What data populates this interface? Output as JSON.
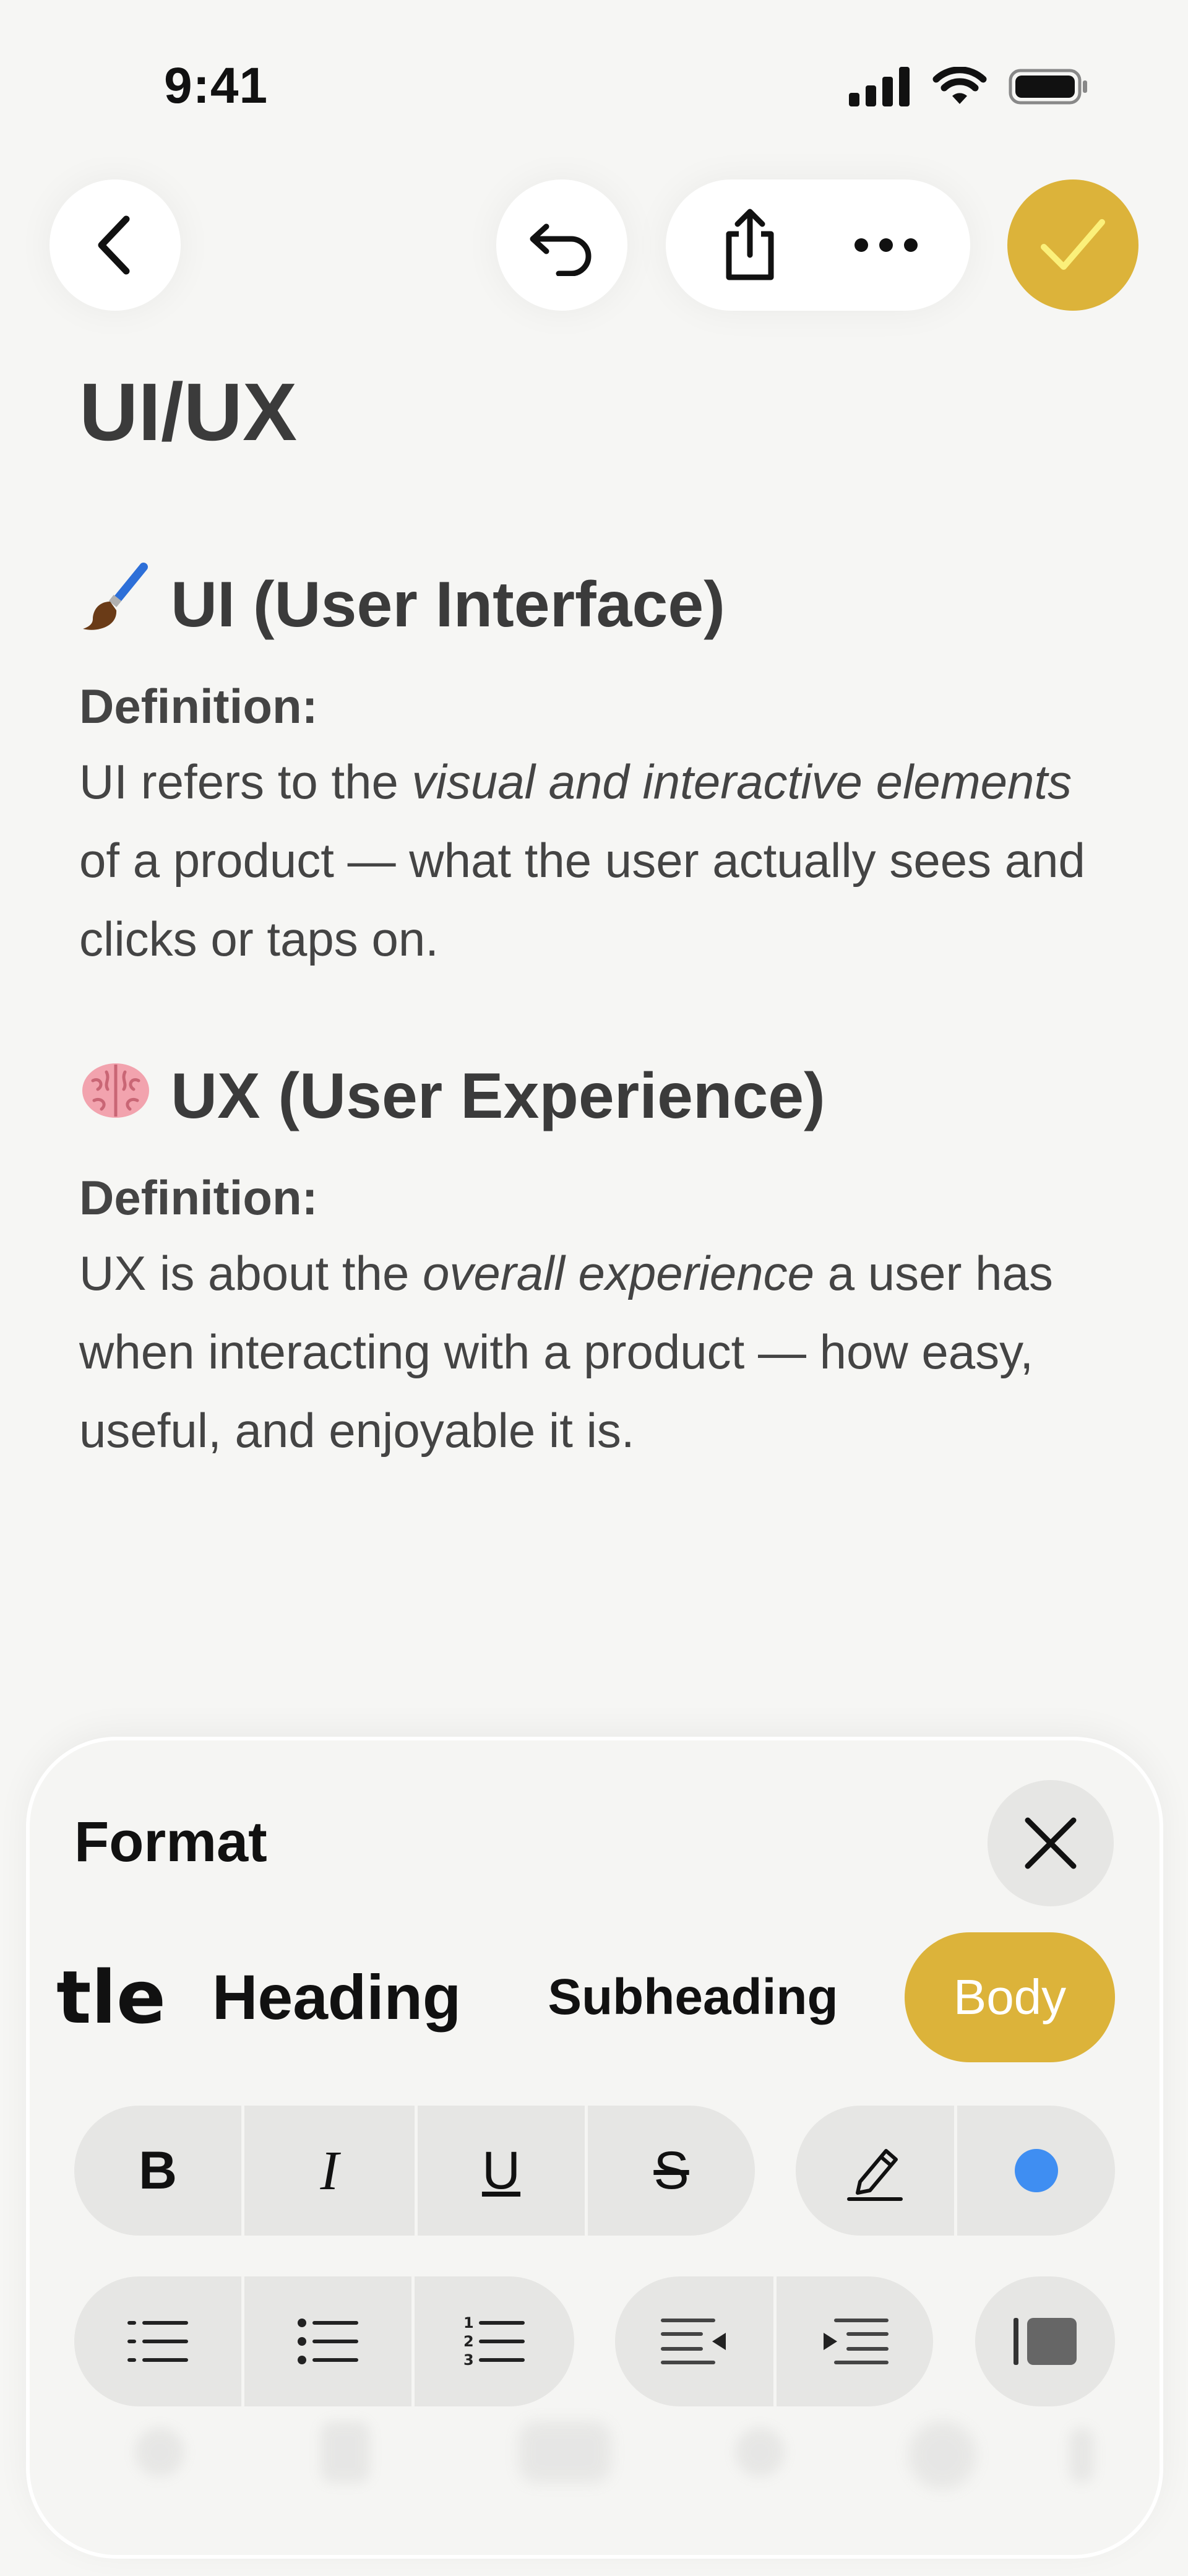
{
  "status_bar": {
    "time": "9:41"
  },
  "toolbar": {
    "back_icon": "chevron-left-icon",
    "undo_icon": "undo-icon",
    "share_icon": "share-icon",
    "more_icon": "ellipsis-icon",
    "done_icon": "checkmark-icon",
    "accent_color": "#dcb33a"
  },
  "note": {
    "title": "UI/UX",
    "sections": [
      {
        "emoji": "paintbrush",
        "heading": "UI (User Interface)",
        "definition_label": "Definition:",
        "text_pre": "UI refers to the ",
        "text_em": "visual and interactive elements",
        "text_post": " of a product — what the user actually sees and clicks or taps on."
      },
      {
        "emoji": "brain",
        "heading": "UX (User Experience)",
        "definition_label": "Definition:",
        "text_pre": "UX is about the ",
        "text_em": "overall experience",
        "text_post": " a user has when interacting with a product — how easy, useful, and enjoyable it is."
      }
    ]
  },
  "format_sheet": {
    "title": "Format",
    "styles": [
      {
        "label": "tle"
      },
      {
        "label": "Heading"
      },
      {
        "label": "Subheading"
      },
      {
        "label": "Body",
        "selected": true
      }
    ],
    "text_buttons": [
      {
        "label": "B",
        "name": "bold"
      },
      {
        "label": "I",
        "name": "italic"
      },
      {
        "label": "U",
        "name": "underline"
      },
      {
        "label": "S",
        "name": "strikethrough"
      }
    ],
    "highlight_icon": "pencil-icon",
    "text_color": "#3f8ef2",
    "list_icons": [
      "dashed-list-icon",
      "bulleted-list-icon",
      "numbered-list-icon"
    ],
    "indent_icons": [
      "decrease-indent-icon",
      "increase-indent-icon"
    ],
    "block_quote_icon": "block-quote-icon"
  }
}
